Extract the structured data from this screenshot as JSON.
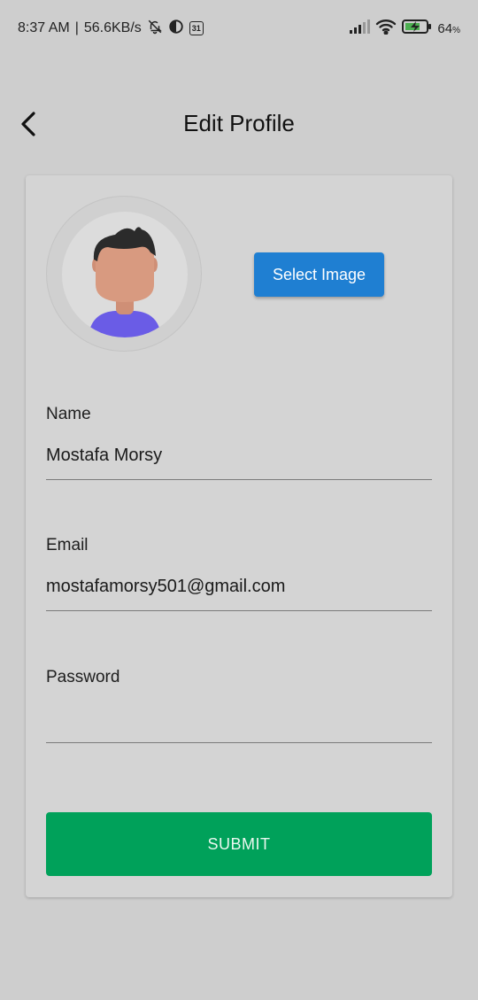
{
  "status_bar": {
    "time": "8:37 AM",
    "speed": "56.6KB/s",
    "calendar_day": "31",
    "battery_pct": "64",
    "battery_unit": "%",
    "icons": [
      "bell-off-icon",
      "vpn-icon",
      "calendar-icon",
      "signal-icon",
      "wifi-icon",
      "battery-charging-icon"
    ]
  },
  "header": {
    "title": "Edit Profile",
    "back_icon": "chevron-left-icon"
  },
  "profile_card": {
    "select_image_label": "Select Image",
    "avatar_icon": "user-avatar-illustration",
    "fields": [
      {
        "label": "Name",
        "value": "Mostafa Morsy"
      },
      {
        "label": "Email",
        "value": "mostafamorsy501@gmail.com"
      },
      {
        "label": "Password",
        "value": ""
      }
    ],
    "submit_label": "SUBMIT"
  },
  "colors": {
    "background": "#cecece",
    "card": "#d4d4d4",
    "select_button": "#1f7fd2",
    "submit_button": "#00a15a",
    "avatar_shirt": "#6a5ce6",
    "avatar_skin": "#d89a80",
    "avatar_hair": "#2b2b2b"
  }
}
